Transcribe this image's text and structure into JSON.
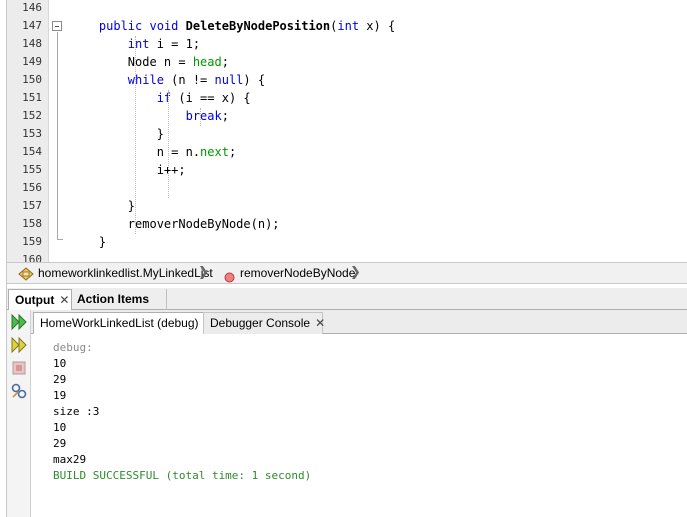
{
  "editor": {
    "lines": [
      {
        "num": "146",
        "code": []
      },
      {
        "num": "147",
        "code": [
          {
            "t": "    ",
            "c": ""
          },
          {
            "t": "public",
            "c": "kw"
          },
          {
            "t": " ",
            "c": ""
          },
          {
            "t": "void",
            "c": "kw"
          },
          {
            "t": " ",
            "c": ""
          },
          {
            "t": "DeleteByNodePosition",
            "c": "mth"
          },
          {
            "t": "(",
            "c": ""
          },
          {
            "t": "int",
            "c": "kw"
          },
          {
            "t": " x) {",
            "c": ""
          }
        ]
      },
      {
        "num": "148",
        "code": [
          {
            "t": "        ",
            "c": ""
          },
          {
            "t": "int",
            "c": "kw"
          },
          {
            "t": " i = 1;",
            "c": ""
          }
        ]
      },
      {
        "num": "149",
        "code": [
          {
            "t": "        Node n = ",
            "c": ""
          },
          {
            "t": "head",
            "c": "fld"
          },
          {
            "t": ";",
            "c": ""
          }
        ]
      },
      {
        "num": "150",
        "code": [
          {
            "t": "        ",
            "c": ""
          },
          {
            "t": "while",
            "c": "kw"
          },
          {
            "t": " (n != ",
            "c": ""
          },
          {
            "t": "null",
            "c": "kw"
          },
          {
            "t": ") {",
            "c": ""
          }
        ]
      },
      {
        "num": "151",
        "code": [
          {
            "t": "            ",
            "c": ""
          },
          {
            "t": "if",
            "c": "kw"
          },
          {
            "t": " (i == x) {",
            "c": ""
          }
        ]
      },
      {
        "num": "152",
        "code": [
          {
            "t": "                ",
            "c": ""
          },
          {
            "t": "break",
            "c": "kw"
          },
          {
            "t": ";",
            "c": ""
          }
        ]
      },
      {
        "num": "153",
        "code": [
          {
            "t": "            }",
            "c": ""
          }
        ]
      },
      {
        "num": "154",
        "code": [
          {
            "t": "            n = n.",
            "c": ""
          },
          {
            "t": "next",
            "c": "fld"
          },
          {
            "t": ";",
            "c": ""
          }
        ]
      },
      {
        "num": "155",
        "code": [
          {
            "t": "            i++;",
            "c": ""
          }
        ]
      },
      {
        "num": "156",
        "code": []
      },
      {
        "num": "157",
        "code": [
          {
            "t": "        }",
            "c": ""
          }
        ]
      },
      {
        "num": "158",
        "code": [
          {
            "t": "        removerNodeByNode(n);",
            "c": ""
          }
        ]
      },
      {
        "num": "159",
        "code": [
          {
            "t": "    }",
            "c": ""
          }
        ]
      },
      {
        "num": "160",
        "code": []
      }
    ]
  },
  "breadcrumb": {
    "class_label": "homeworklinkedlist.MyLinkedList",
    "method_label": "removerNodeByNode",
    "class_icon": "class-icon",
    "method_icon": "method-icon",
    "separator": "❯"
  },
  "output_window": {
    "tabs": [
      {
        "label": "Output",
        "close": "✕"
      },
      {
        "label": "Action Items"
      }
    ],
    "subtabs": [
      {
        "label": "HomeWorkLinkedList (debug)",
        "close": "✕"
      },
      {
        "label": "Debugger Console",
        "close": "✕"
      }
    ],
    "toolbar_icons": [
      "rerun-icon",
      "rerun-different-params-icon",
      "stop-icon",
      "settings-icon"
    ],
    "console_lines": [
      {
        "text": "debug:",
        "style": "gray"
      },
      {
        "text": "10",
        "style": ""
      },
      {
        "text": "29",
        "style": ""
      },
      {
        "text": "19",
        "style": ""
      },
      {
        "text": "size :3",
        "style": ""
      },
      {
        "text": "10",
        "style": ""
      },
      {
        "text": "29",
        "style": ""
      },
      {
        "text": "max29",
        "style": ""
      },
      {
        "text": "BUILD SUCCESSFUL (total time: 1 second)",
        "style": "green"
      }
    ]
  },
  "colors": {
    "keyword": "#0000e6",
    "field": "#009900",
    "console_success": "#2e8b2e",
    "console_muted": "#8a8a8a",
    "run_icon": "#3aa63a",
    "method_icon": "#e05050"
  }
}
